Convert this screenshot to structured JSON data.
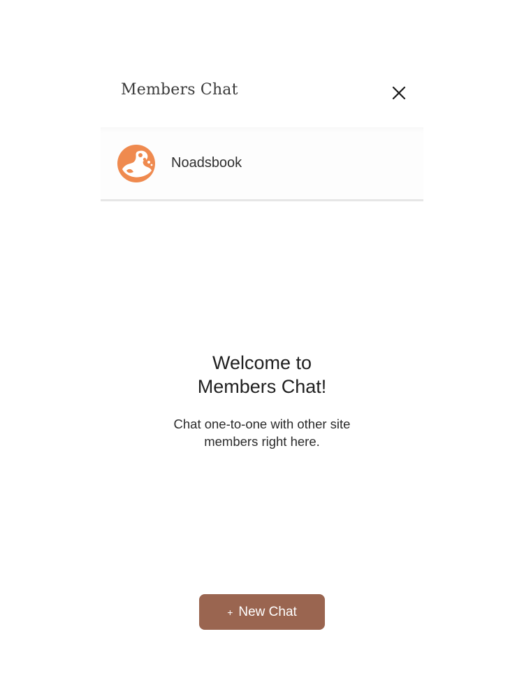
{
  "header": {
    "title": "Members Chat",
    "close_icon": "close-icon"
  },
  "site_row": {
    "name": "Noadsbook",
    "avatar_icon": "site-logo-icon",
    "avatar_color": "#ef8a4f"
  },
  "welcome": {
    "title_line1": "Welcome to",
    "title_line2": "Members Chat!",
    "text_line1": "Chat one-to-one with other site",
    "text_line2": "members right here."
  },
  "new_chat": {
    "icon": "+",
    "label": "New Chat",
    "bg_color": "#9a6550"
  },
  "colors": {
    "background": "#ffffff",
    "divider": "#e6e6e6",
    "accent": "#ef8a4f"
  }
}
